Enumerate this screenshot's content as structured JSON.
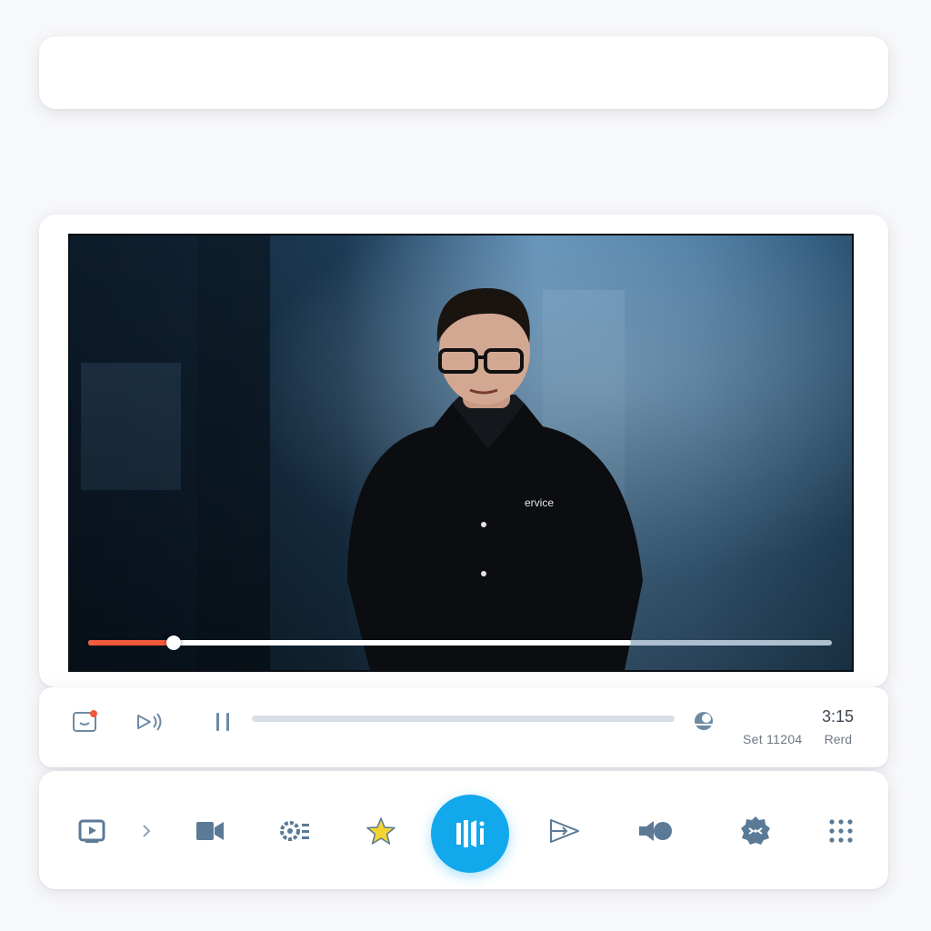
{
  "top_bar": {
    "text": ""
  },
  "player": {
    "video": {
      "shirt_text": "ervice",
      "playback_progress_percent": 11.5,
      "buffered_percent": 73
    },
    "controls": {
      "time": "3:15",
      "meta_left": "Set 11204",
      "meta_right": "Rerd",
      "sub_progress_percent": 0
    }
  },
  "toolbar": {
    "items": [
      {
        "icon": "video-frame-icon"
      },
      {
        "icon": "chevron-right-icon"
      },
      {
        "icon": "camera-icon"
      },
      {
        "icon": "gear-list-icon"
      },
      {
        "icon": "star-icon"
      },
      {
        "icon": "record-main-icon",
        "active": true
      },
      {
        "icon": "send-icon"
      },
      {
        "icon": "speaker-icon"
      },
      {
        "icon": "badge-icon"
      },
      {
        "icon": "grid-icon"
      }
    ]
  },
  "colors": {
    "accent": "#12a8ec",
    "progress": "#f15a3c",
    "icon": "#5b7a96",
    "star": "#f5d431"
  }
}
